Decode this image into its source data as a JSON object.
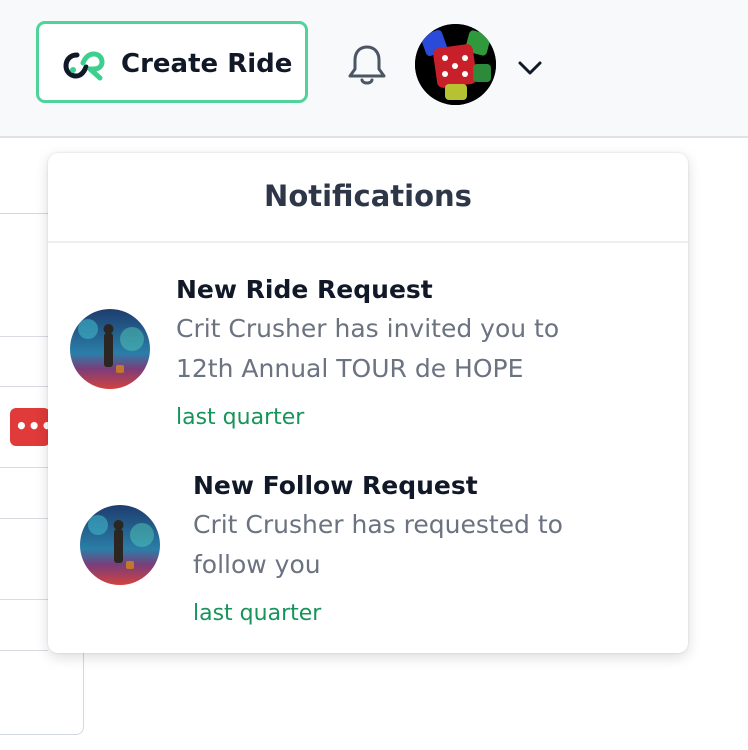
{
  "header": {
    "create_ride_label": "Create Ride",
    "icons": {
      "logo": "link-logo-icon",
      "notifications": "bell-icon",
      "account_menu": "chevron-down-icon"
    }
  },
  "notifications": {
    "title": "Notifications",
    "items": [
      {
        "title": "New Ride Request",
        "text": "Crit Crusher has invited you to 12th Annual TOUR de HOPE",
        "time": "last quarter"
      },
      {
        "title": "New Follow Request",
        "text": "Crit Crusher has requested to follow you",
        "time": "last quarter"
      }
    ]
  },
  "background": {
    "more_badge": "•••"
  },
  "colors": {
    "accent_border": "#4fd39a",
    "time_text": "#17945a",
    "badge_red": "#e03a3a"
  }
}
